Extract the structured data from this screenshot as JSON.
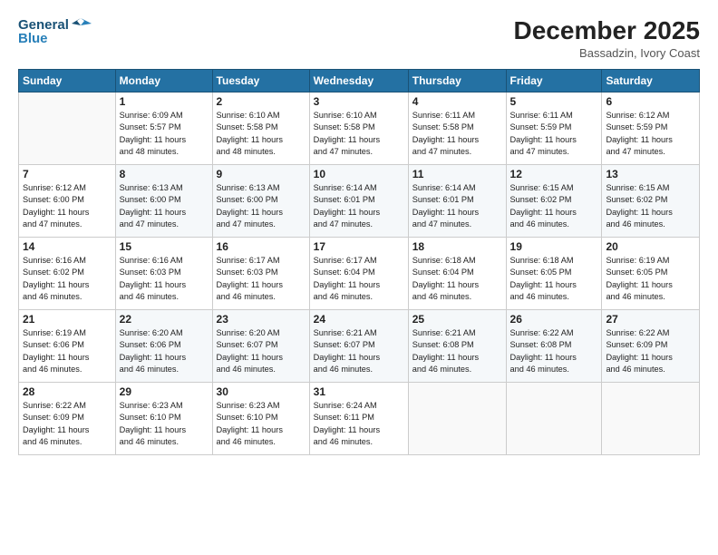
{
  "header": {
    "logo_line1": "General",
    "logo_line2": "Blue",
    "month_year": "December 2025",
    "location": "Bassadzin, Ivory Coast"
  },
  "days_of_week": [
    "Sunday",
    "Monday",
    "Tuesday",
    "Wednesday",
    "Thursday",
    "Friday",
    "Saturday"
  ],
  "weeks": [
    [
      {
        "day": "",
        "info": ""
      },
      {
        "day": "1",
        "info": "Sunrise: 6:09 AM\nSunset: 5:57 PM\nDaylight: 11 hours\nand 48 minutes."
      },
      {
        "day": "2",
        "info": "Sunrise: 6:10 AM\nSunset: 5:58 PM\nDaylight: 11 hours\nand 48 minutes."
      },
      {
        "day": "3",
        "info": "Sunrise: 6:10 AM\nSunset: 5:58 PM\nDaylight: 11 hours\nand 47 minutes."
      },
      {
        "day": "4",
        "info": "Sunrise: 6:11 AM\nSunset: 5:58 PM\nDaylight: 11 hours\nand 47 minutes."
      },
      {
        "day": "5",
        "info": "Sunrise: 6:11 AM\nSunset: 5:59 PM\nDaylight: 11 hours\nand 47 minutes."
      },
      {
        "day": "6",
        "info": "Sunrise: 6:12 AM\nSunset: 5:59 PM\nDaylight: 11 hours\nand 47 minutes."
      }
    ],
    [
      {
        "day": "7",
        "info": "Sunrise: 6:12 AM\nSunset: 6:00 PM\nDaylight: 11 hours\nand 47 minutes."
      },
      {
        "day": "8",
        "info": "Sunrise: 6:13 AM\nSunset: 6:00 PM\nDaylight: 11 hours\nand 47 minutes."
      },
      {
        "day": "9",
        "info": "Sunrise: 6:13 AM\nSunset: 6:00 PM\nDaylight: 11 hours\nand 47 minutes."
      },
      {
        "day": "10",
        "info": "Sunrise: 6:14 AM\nSunset: 6:01 PM\nDaylight: 11 hours\nand 47 minutes."
      },
      {
        "day": "11",
        "info": "Sunrise: 6:14 AM\nSunset: 6:01 PM\nDaylight: 11 hours\nand 47 minutes."
      },
      {
        "day": "12",
        "info": "Sunrise: 6:15 AM\nSunset: 6:02 PM\nDaylight: 11 hours\nand 46 minutes."
      },
      {
        "day": "13",
        "info": "Sunrise: 6:15 AM\nSunset: 6:02 PM\nDaylight: 11 hours\nand 46 minutes."
      }
    ],
    [
      {
        "day": "14",
        "info": "Sunrise: 6:16 AM\nSunset: 6:02 PM\nDaylight: 11 hours\nand 46 minutes."
      },
      {
        "day": "15",
        "info": "Sunrise: 6:16 AM\nSunset: 6:03 PM\nDaylight: 11 hours\nand 46 minutes."
      },
      {
        "day": "16",
        "info": "Sunrise: 6:17 AM\nSunset: 6:03 PM\nDaylight: 11 hours\nand 46 minutes."
      },
      {
        "day": "17",
        "info": "Sunrise: 6:17 AM\nSunset: 6:04 PM\nDaylight: 11 hours\nand 46 minutes."
      },
      {
        "day": "18",
        "info": "Sunrise: 6:18 AM\nSunset: 6:04 PM\nDaylight: 11 hours\nand 46 minutes."
      },
      {
        "day": "19",
        "info": "Sunrise: 6:18 AM\nSunset: 6:05 PM\nDaylight: 11 hours\nand 46 minutes."
      },
      {
        "day": "20",
        "info": "Sunrise: 6:19 AM\nSunset: 6:05 PM\nDaylight: 11 hours\nand 46 minutes."
      }
    ],
    [
      {
        "day": "21",
        "info": "Sunrise: 6:19 AM\nSunset: 6:06 PM\nDaylight: 11 hours\nand 46 minutes."
      },
      {
        "day": "22",
        "info": "Sunrise: 6:20 AM\nSunset: 6:06 PM\nDaylight: 11 hours\nand 46 minutes."
      },
      {
        "day": "23",
        "info": "Sunrise: 6:20 AM\nSunset: 6:07 PM\nDaylight: 11 hours\nand 46 minutes."
      },
      {
        "day": "24",
        "info": "Sunrise: 6:21 AM\nSunset: 6:07 PM\nDaylight: 11 hours\nand 46 minutes."
      },
      {
        "day": "25",
        "info": "Sunrise: 6:21 AM\nSunset: 6:08 PM\nDaylight: 11 hours\nand 46 minutes."
      },
      {
        "day": "26",
        "info": "Sunrise: 6:22 AM\nSunset: 6:08 PM\nDaylight: 11 hours\nand 46 minutes."
      },
      {
        "day": "27",
        "info": "Sunrise: 6:22 AM\nSunset: 6:09 PM\nDaylight: 11 hours\nand 46 minutes."
      }
    ],
    [
      {
        "day": "28",
        "info": "Sunrise: 6:22 AM\nSunset: 6:09 PM\nDaylight: 11 hours\nand 46 minutes."
      },
      {
        "day": "29",
        "info": "Sunrise: 6:23 AM\nSunset: 6:10 PM\nDaylight: 11 hours\nand 46 minutes."
      },
      {
        "day": "30",
        "info": "Sunrise: 6:23 AM\nSunset: 6:10 PM\nDaylight: 11 hours\nand 46 minutes."
      },
      {
        "day": "31",
        "info": "Sunrise: 6:24 AM\nSunset: 6:11 PM\nDaylight: 11 hours\nand 46 minutes."
      },
      {
        "day": "",
        "info": ""
      },
      {
        "day": "",
        "info": ""
      },
      {
        "day": "",
        "info": ""
      }
    ]
  ]
}
